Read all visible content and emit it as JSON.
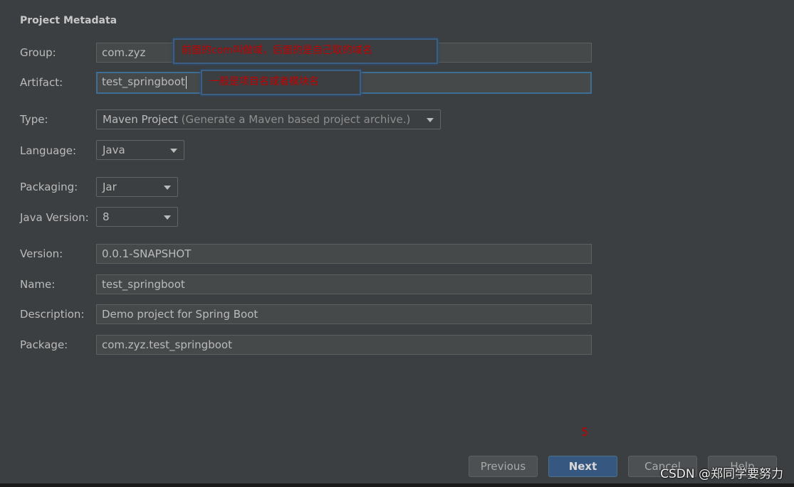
{
  "section": {
    "title": "Project Metadata"
  },
  "fields": {
    "group": {
      "label": "Group:",
      "value": "com.zyz"
    },
    "artifact": {
      "label": "Artifact:",
      "value": "test_springboot"
    },
    "type": {
      "label": "Type:",
      "value": "Maven Project",
      "hint": "(Generate a Maven based project archive.)"
    },
    "language": {
      "label": "Language:",
      "value": "Java"
    },
    "packaging": {
      "label": "Packaging:",
      "value": "Jar"
    },
    "java_version": {
      "label": "Java Version:",
      "value": "8"
    },
    "version": {
      "label": "Version:",
      "value": "0.0.1-SNAPSHOT"
    },
    "name": {
      "label": "Name:",
      "value": "test_springboot"
    },
    "description": {
      "label": "Description:",
      "value": "Demo project for Spring Boot"
    },
    "package": {
      "label": "Package:",
      "value": "com.zyz.test_springboot"
    }
  },
  "annotations": {
    "group_note": "前面的com叫做域，后面的是自己取的域名",
    "artifact_note": "一般是项目名或者模块名",
    "step_mark": "5"
  },
  "buttons": {
    "previous": "Previous",
    "next": "Next",
    "cancel": "Cancel",
    "help": "Help"
  },
  "watermark": "CSDN @郑同学要努力",
  "colors": {
    "background": "#3c3f41",
    "field_bg": "#45494a",
    "focus_border": "#3d6f96",
    "primary_button": "#365880",
    "annotation_red": "#c00000"
  }
}
